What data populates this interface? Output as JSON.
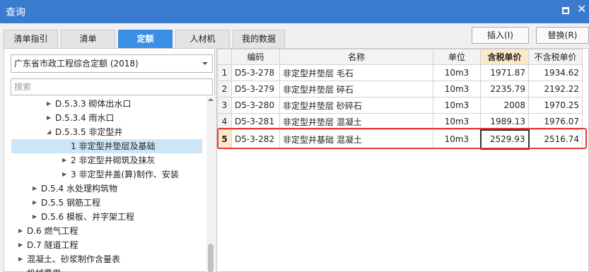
{
  "window": {
    "title": "查询"
  },
  "tabs": [
    {
      "label": "清单指引",
      "active": false
    },
    {
      "label": "清单",
      "active": false
    },
    {
      "label": "定额",
      "active": true
    },
    {
      "label": "人材机",
      "active": false
    },
    {
      "label": "我的数据",
      "active": false
    }
  ],
  "toolbar": {
    "insert_label": "插入(I)",
    "replace_label": "替换(R)"
  },
  "left": {
    "library_select": "广东省市政工程综合定额 (2018)",
    "search_placeholder": "搜索",
    "tree": [
      {
        "label": "D.5.3.3 砌体出水口",
        "arrow": "▶"
      },
      {
        "label": "D.5.3.4 雨水口",
        "arrow": "▶"
      },
      {
        "label": "D.5.3.5 非定型井",
        "arrow": "◢"
      },
      {
        "label": "1 非定型井垫层及基础",
        "arrow": "",
        "selected": true
      },
      {
        "label": "2 非定型井砌筑及抹灰",
        "arrow": "▶"
      },
      {
        "label": "3 非定型井盖(算)制作、安装",
        "arrow": "▶"
      },
      {
        "label": "D.5.4 水处理构筑物",
        "arrow": "▶"
      },
      {
        "label": "D.5.5 钢筋工程",
        "arrow": "▶"
      },
      {
        "label": "D.5.6 模板、井字架工程",
        "arrow": "▶"
      },
      {
        "label": "D.6 燃气工程",
        "arrow": "▶"
      },
      {
        "label": "D.7 隧道工程",
        "arrow": "▶"
      },
      {
        "label": "混凝土、砂浆制作含量表",
        "arrow": "▶"
      },
      {
        "label": "机械费用",
        "arrow": ""
      }
    ]
  },
  "grid": {
    "headers": [
      "",
      "编码",
      "名称",
      "单位",
      "含税单价",
      "不含税单价"
    ],
    "rows": [
      {
        "idx": "1",
        "code": "D5-3-278",
        "name": "非定型井垫层 毛石",
        "unit": "10m3",
        "tax_price": "1971.87",
        "notax_price": "1934.62"
      },
      {
        "idx": "2",
        "code": "D5-3-279",
        "name": "非定型井垫层 碎石",
        "unit": "10m3",
        "tax_price": "2235.79",
        "notax_price": "2192.22"
      },
      {
        "idx": "3",
        "code": "D5-3-280",
        "name": "非定型井垫层 砂碎石",
        "unit": "10m3",
        "tax_price": "2008",
        "notax_price": "1970.25"
      },
      {
        "idx": "4",
        "code": "D5-3-281",
        "name": "非定型井垫层 混凝土",
        "unit": "10m3",
        "tax_price": "1989.13",
        "notax_price": "1976.07"
      },
      {
        "idx": "5",
        "code": "D5-3-282",
        "name": "非定型井基础 混凝土",
        "unit": "10m3",
        "tax_price": "2529.93",
        "notax_price": "2516.74",
        "selected": true
      }
    ]
  }
}
